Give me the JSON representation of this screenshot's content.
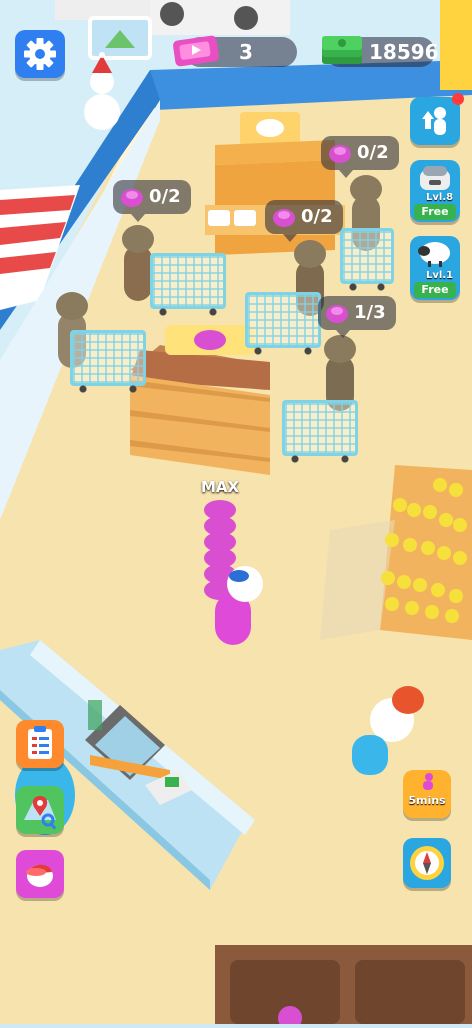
{
  "hud": {
    "tickets": "3",
    "cash": "18596"
  },
  "bubbles": [
    {
      "text": "0/2"
    },
    {
      "text": "0/2"
    },
    {
      "text": "0/2"
    },
    {
      "text": "1/3"
    }
  ],
  "player": {
    "stack_label": "MAX"
  },
  "side_buttons": {
    "upgrade_1": {
      "level": "Lvl.8",
      "action": "Free"
    },
    "upgrade_2": {
      "level": "Lvl.1",
      "action": "Free"
    },
    "boost": {
      "label": "5mins"
    }
  },
  "icons": {
    "settings": "gear-icon",
    "ticket": "ticket-icon",
    "cash": "cash-stack-icon",
    "staff": "staff-upgrade-icon",
    "tasks": "clipboard-icon",
    "map": "map-icon",
    "skin": "cap-icon",
    "compass": "compass-icon"
  },
  "colors": {
    "floor": "#f7e3ad",
    "wall": "#3d8fe0",
    "counter": "#cdeaf6",
    "crate": "#f2b35e",
    "player": "#e04ad9",
    "cash": "#37b24d"
  }
}
